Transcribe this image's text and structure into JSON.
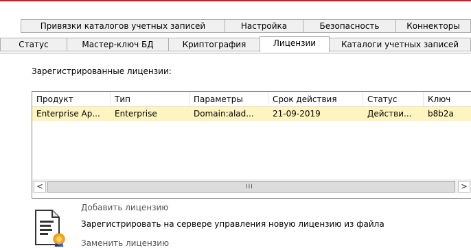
{
  "tabs_row1": [
    {
      "label": "Привязки каталогов учетных записей"
    },
    {
      "label": "Настройка"
    },
    {
      "label": "Безопасность"
    },
    {
      "label": "Коннекторы"
    }
  ],
  "tabs_row2": [
    {
      "label": "Статус"
    },
    {
      "label": "Мастер-ключ БД"
    },
    {
      "label": "Криптография"
    },
    {
      "label": "Лицензии",
      "active": true
    },
    {
      "label": "Каталоги учетных записей"
    }
  ],
  "licenses": {
    "title": "Зарегистрированные лицензии:",
    "columns": [
      "Продукт",
      "Тип",
      "Параметры",
      "Срок действия",
      "Статус",
      "Ключ"
    ],
    "rows": [
      [
        "Enterprise Ap...",
        "Enterprise",
        "Domain:alad...",
        "21-09-2019",
        "Действи...",
        "b8b2a"
      ]
    ],
    "scroll_grip": "III",
    "scroll_left": "<",
    "scroll_right": ">"
  },
  "actions": {
    "add_license": "Добавить лицензию",
    "add_license_desc": "Зарегистрировать на сервере управления новую лицензию из файла",
    "replace_license": "Заменить лицензию"
  },
  "colors": {
    "selected_row": "#fdf4bf",
    "accent_line": "#e81123"
  }
}
